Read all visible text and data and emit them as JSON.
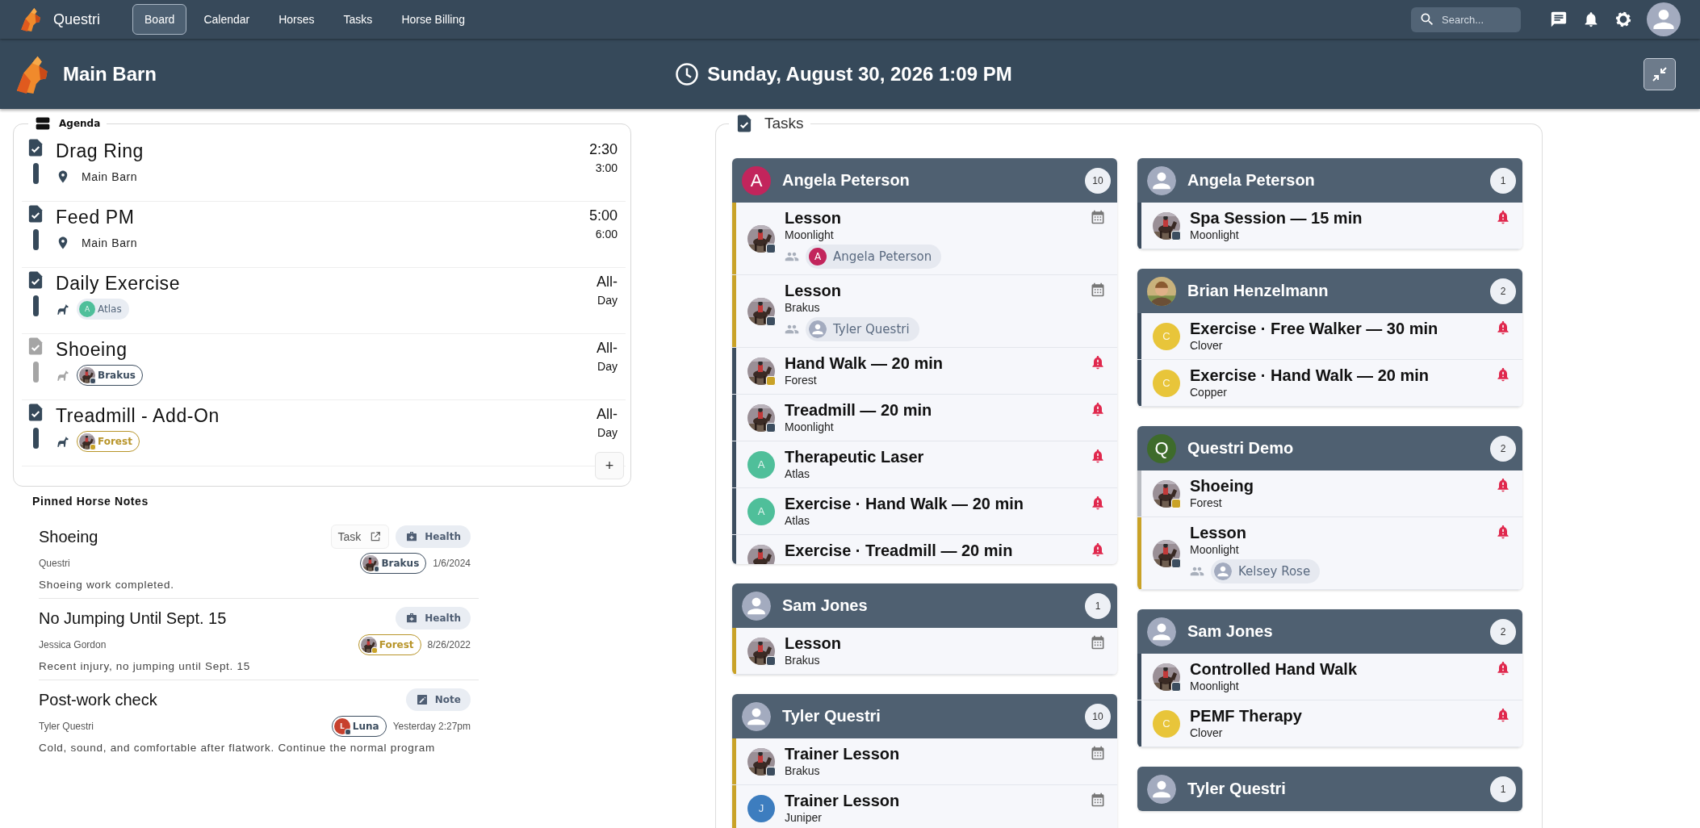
{
  "nav": {
    "brand": "Questri",
    "items": [
      {
        "label": "Board",
        "selected": true
      },
      {
        "label": "Calendar",
        "selected": false
      },
      {
        "label": "Horses",
        "selected": false
      },
      {
        "label": "Tasks",
        "selected": false
      },
      {
        "label": "Horse Billing",
        "selected": false
      }
    ],
    "search": {
      "placeholder": "Search..."
    }
  },
  "header": {
    "title": "Main Barn",
    "datetime": "Sunday, August 30, 2026 1:09 PM"
  },
  "agenda": {
    "title": "Agenda",
    "items": [
      {
        "title": "Drag Ring",
        "disabled": false,
        "detail": {
          "kind": "location",
          "text": "Main Barn"
        },
        "start": "2:30",
        "end": "3:00"
      },
      {
        "title": "Feed PM",
        "disabled": false,
        "detail": {
          "kind": "location",
          "text": "Main Barn"
        },
        "start": "5:00",
        "end": "6:00"
      },
      {
        "title": "Daily Exercise",
        "disabled": false,
        "detail": {
          "kind": "horse",
          "horse": {
            "name": "Atlas",
            "avatar": {
              "kind": "letter",
              "letter": "A",
              "color": "#4fbf9a"
            }
          }
        },
        "start": "All-",
        "end": "Day"
      },
      {
        "title": "Shoeing",
        "disabled": true,
        "detail": {
          "kind": "horse",
          "horse": {
            "name": "Brakus",
            "color": "#3c4d5f",
            "avatar": {
              "kind": "picture",
              "badge": {
                "color": "#3c4d5f"
              }
            }
          }
        },
        "start": "All-",
        "end": "Day"
      },
      {
        "title": "Treadmill - Add-On",
        "disabled": false,
        "detail": {
          "kind": "horse",
          "horse": {
            "name": "Forest",
            "color": "#b8952a",
            "avatar": {
              "kind": "picture",
              "badge": {
                "color": "#c9a227"
              }
            }
          }
        },
        "start": "All-",
        "end": "Day"
      }
    ],
    "add_label": "+"
  },
  "pinned_notes": {
    "title": "Pinned Horse Notes",
    "items": [
      {
        "title": "Shoeing",
        "task_link": "Task",
        "tag": {
          "kind": "health",
          "label": "Health"
        },
        "author": "Questri",
        "horse": {
          "name": "Brakus",
          "color": "#3c4d5f",
          "avatar": {
            "kind": "picture",
            "badge": {
              "color": "#3c4d5f"
            }
          }
        },
        "date": "1/6/2024",
        "body": "Shoeing work completed."
      },
      {
        "title": "No Jumping Until Sept. 15",
        "tag": {
          "kind": "health",
          "label": "Health"
        },
        "author": "Jessica Gordon",
        "horse": {
          "name": "Forest",
          "color": "#b8952a",
          "avatar": {
            "kind": "picture",
            "badge": {
              "color": "#c9a227"
            }
          }
        },
        "date": "8/26/2022",
        "body": "Recent injury, no jumping until Sept. 15"
      },
      {
        "title": "Post-work check",
        "tag": {
          "kind": "note",
          "label": "Note"
        },
        "author": "Tyler Questri",
        "horse": {
          "name": "Luna",
          "color": "#3c4d5f",
          "avatar": {
            "kind": "letter",
            "letter": "L",
            "color": "#c7402d",
            "badge": {
              "color": "#3c4d5f"
            }
          }
        },
        "date": "Yesterday 2:27pm",
        "body": "Cold, sound, and comfortable after flatwork. Continue the normal program"
      }
    ]
  },
  "tasks": {
    "title": "Tasks",
    "columns": [
      {
        "groups": [
          {
            "name": "Angela Peterson",
            "avatar": {
              "kind": "letter",
              "letter": "A",
              "color": "#c2255c"
            },
            "count": "10",
            "items": [
              {
                "title": "Lesson",
                "subtitle": "Moonlight",
                "color": "#c9a227",
                "kind": "event",
                "avatar": {
                  "kind": "picture",
                  "badge": {
                    "color": "#3c4d5f"
                  }
                },
                "participant": {
                  "name": "Angela Peterson",
                  "avatar": {
                    "kind": "letter",
                    "letter": "A",
                    "color": "#c2255c"
                  }
                }
              },
              {
                "title": "Lesson",
                "subtitle": "Brakus",
                "color": "#c9a227",
                "kind": "event",
                "avatar": {
                  "kind": "picture",
                  "badge": {
                    "color": "#3c4d5f"
                  }
                },
                "participant": {
                  "name": "Tyler Questri",
                  "avatar": {
                    "kind": "person"
                  }
                }
              },
              {
                "title": "Hand Walk — 20 min",
                "subtitle": "Forest",
                "color": "#3c4d5f",
                "kind": "alert",
                "avatar": {
                  "kind": "picture",
                  "badge": {
                    "color": "#c9a227"
                  }
                }
              },
              {
                "title": "Treadmill — 20 min",
                "subtitle": "Moonlight",
                "color": "#3c4d5f",
                "kind": "alert",
                "avatar": {
                  "kind": "picture",
                  "badge": {
                    "color": "#3c4d5f"
                  }
                }
              },
              {
                "title": "Therapeutic Laser",
                "subtitle": "Atlas",
                "color": "#3c4d5f",
                "kind": "alert",
                "avatar": {
                  "kind": "letter",
                  "letter": "A",
                  "color": "#4fbf9a"
                }
              },
              {
                "title": "Exercise · Hand Walk — 20 min",
                "subtitle": "Atlas",
                "color": "#3c4d5f",
                "kind": "alert",
                "avatar": {
                  "kind": "letter",
                  "letter": "A",
                  "color": "#4fbf9a"
                }
              },
              {
                "title": "Exercise · Treadmill — 20 min",
                "color": "#3c4d5f",
                "kind": "alert",
                "avatar": {
                  "kind": "picture"
                }
              }
            ]
          },
          {
            "name": "Sam Jones",
            "avatar": {
              "kind": "person"
            },
            "count": "1",
            "items": [
              {
                "title": "Lesson",
                "subtitle": "Brakus",
                "color": "#c9a227",
                "kind": "event",
                "avatar": {
                  "kind": "picture",
                  "badge": {
                    "color": "#3c4d5f"
                  }
                }
              }
            ]
          },
          {
            "name": "Tyler Questri",
            "avatar": {
              "kind": "person"
            },
            "count": "10",
            "items": [
              {
                "title": "Trainer Lesson",
                "subtitle": "Brakus",
                "color": "#c9a227",
                "kind": "event",
                "avatar": {
                  "kind": "picture",
                  "badge": {
                    "color": "#3c4d5f"
                  }
                }
              },
              {
                "title": "Trainer Lesson",
                "subtitle": "Juniper",
                "color": "#c9a227",
                "kind": "event",
                "avatar": {
                  "kind": "letter",
                  "letter": "J",
                  "color": "#3d7dbf"
                }
              }
            ]
          }
        ]
      },
      {
        "groups": [
          {
            "name": "Angela Peterson",
            "avatar": {
              "kind": "person"
            },
            "count": "1",
            "items": [
              {
                "title": "Spa Session — 15 min",
                "subtitle": "Moonlight",
                "color": "#3c4d5f",
                "kind": "alert",
                "avatar": {
                  "kind": "picture",
                  "badge": {
                    "color": "#3c4d5f"
                  }
                }
              }
            ]
          },
          {
            "name": "Brian Henzelmann",
            "avatar": {
              "kind": "picture"
            },
            "count": "2",
            "items": [
              {
                "title": "Exercise · Free Walker — 30 min",
                "subtitle": "Clover",
                "color": "#3c4d5f",
                "kind": "alert",
                "avatar": {
                  "kind": "letter",
                  "letter": "C",
                  "color": "#e8c53a"
                }
              },
              {
                "title": "Exercise · Hand Walk — 20 min",
                "subtitle": "Copper",
                "color": "#3c4d5f",
                "kind": "alert",
                "avatar": {
                  "kind": "letter",
                  "letter": "C",
                  "color": "#e8c53a"
                }
              }
            ]
          },
          {
            "name": "Questri Demo",
            "avatar": {
              "kind": "letter",
              "letter": "Q",
              "color": "#3e6b2b"
            },
            "count": "2",
            "items": [
              {
                "title": "Shoeing",
                "subtitle": "Forest",
                "color": "#b9bcc2",
                "kind": "alert",
                "avatar": {
                  "kind": "picture",
                  "badge": {
                    "color": "#c9a227"
                  }
                }
              },
              {
                "title": "Lesson",
                "subtitle": "Moonlight",
                "color": "#c9a227",
                "kind": "alert",
                "avatar": {
                  "kind": "picture",
                  "badge": {
                    "color": "#3c4d5f"
                  }
                },
                "participant": {
                  "name": "Kelsey Rose",
                  "avatar": {
                    "kind": "person"
                  }
                }
              }
            ]
          },
          {
            "name": "Sam Jones",
            "avatar": {
              "kind": "person"
            },
            "count": "2",
            "items": [
              {
                "title": "Controlled Hand Walk",
                "subtitle": "Moonlight",
                "color": "#3c4d5f",
                "kind": "alert",
                "avatar": {
                  "kind": "picture",
                  "badge": {
                    "color": "#3c4d5f"
                  }
                }
              },
              {
                "title": "PEMF Therapy",
                "subtitle": "Clover",
                "color": "#3c4d5f",
                "kind": "alert",
                "avatar": {
                  "kind": "letter",
                  "letter": "C",
                  "color": "#e8c53a"
                }
              }
            ]
          },
          {
            "name": "Tyler Questri",
            "avatar": {
              "kind": "person"
            },
            "count": "1"
          }
        ]
      }
    ]
  }
}
